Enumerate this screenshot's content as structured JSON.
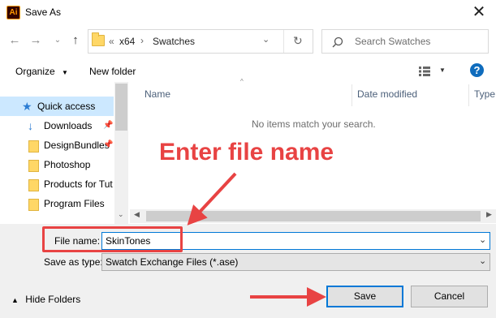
{
  "window": {
    "title": "Save As",
    "app_icon": "Ai",
    "close_icon": "close-icon"
  },
  "address": {
    "prefix": "«",
    "crumbs": [
      "x64",
      "Swatches"
    ],
    "search_placeholder": "Search Swatches"
  },
  "toolbar": {
    "organize": "Organize",
    "new_folder": "New folder"
  },
  "sidebar": {
    "items": [
      {
        "label": "Quick access",
        "icon": "star-icon",
        "selected": true
      },
      {
        "label": "Downloads",
        "icon": "download-icon",
        "pinned": true
      },
      {
        "label": "DesignBundles",
        "icon": "folder-icon",
        "pinned": true
      },
      {
        "label": "Photoshop",
        "icon": "folder-icon"
      },
      {
        "label": "Products for Tut",
        "icon": "folder-icon"
      },
      {
        "label": "Program Files",
        "icon": "folder-icon"
      }
    ]
  },
  "list": {
    "columns": [
      "Name",
      "Date modified",
      "Type"
    ],
    "empty_message": "No items match your search."
  },
  "form": {
    "file_name_label": "File name:",
    "file_name_value": "SkinTones",
    "save_type_label": "Save as type:",
    "save_type_value": "Swatch Exchange Files (*.ase)"
  },
  "footer": {
    "hide_folders": "Hide Folders",
    "save": "Save",
    "cancel": "Cancel"
  },
  "annotation": {
    "text": "Enter file name",
    "color": "#e84343"
  }
}
